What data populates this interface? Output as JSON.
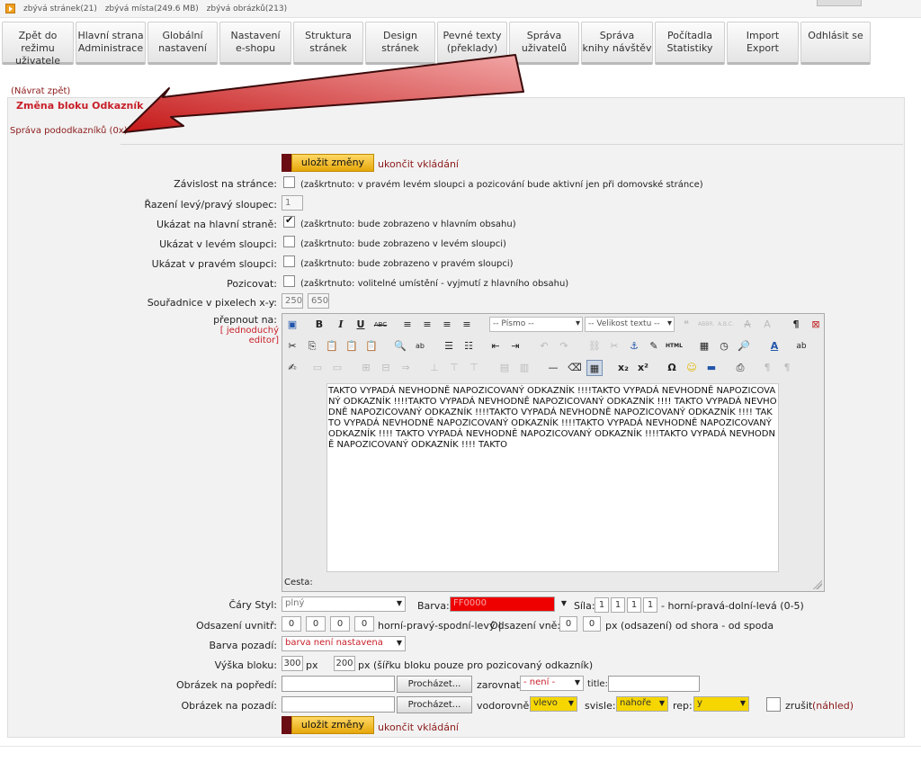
{
  "topbar": {
    "stat_pages": "zbývá stránek(21)",
    "stat_space": "zbývá místa(249.6 MB)",
    "stat_images": "zbývá obrázků(213)"
  },
  "nav": {
    "items": [
      "Zpět do režimu\nuživatele",
      "Hlavní strana\nAdministrace",
      "Globální\nnastavení",
      "Nastavení\ne-shopu",
      "Struktura\nstránek",
      "Design\nstránek",
      "Pevné texty\n(překlady)",
      "Správa\nuživatelů",
      "Správa\nknihy návštěv",
      "Počítadla\nStatistiky",
      "Import\nExport",
      "Odhlásit se"
    ]
  },
  "page": {
    "back_link": "(Návrat zpět)",
    "title": "Změna bloku Odkazník",
    "sub_link": "Správa pododkazníků (0x)"
  },
  "actions": {
    "save_label": "uložit změny",
    "end_label": "ukončit vkládání"
  },
  "form": {
    "dependency_label": "Závislost na stránce:",
    "dependency_note": "(zaškrtnuto: v pravém levém sloupci a pozicování bude aktivní jen při domovské stránce)",
    "order_label": "Řazení levý/pravý sloupec:",
    "order_value": "1",
    "main_label": "Ukázat na hlavní straně:",
    "main_note": "(zaškrtnuto: bude zobrazeno v hlavním obsahu)",
    "main_checked": true,
    "left_label": "Ukázat v levém sloupci:",
    "left_note": "(zaškrtnuto: bude zobrazeno v levém sloupci)",
    "right_label": "Ukázat v pravém sloupci:",
    "right_note": "(zaškrtnuto: bude zobrazeno v pravém sloupci)",
    "position_label": "Pozicovat:",
    "position_note": "(zaškrtnuto: volitelné umístění - vyjmutí z hlavního obsahu)",
    "coords_label": "Souřadnice v pixelech x-y:",
    "coord_x": "250",
    "coord_y": "650",
    "switch_label": "přepnout na:",
    "simple_editor": "[ jednoduchý editor]"
  },
  "editor": {
    "font_dropdown": "-- Písmo --",
    "size_dropdown": "-- Velikost textu --",
    "content": "TAKTO VYPADÁ NEVHODNĚ NAPOZICOVANÝ ODKAZNÍK !!!!TAKTO VYPADÁ NEVHODNĚ NAPOZICOVANÝ ODKAZNÍK !!!!TAKTO VYPADÁ NEVHODNĚ NAPOZICOVANÝ ODKAZNÍK !!!! TAKTO VYPADÁ NEVHODNĚ NAPOZICOVANÝ ODKAZNÍK !!!!TAKTO VYPADÁ NEVHODNĚ NAPOZICOVANÝ ODKAZNÍK !!!! TAKTO VYPADÁ NEVHODNĚ NAPOZICOVANÝ ODKAZNÍK !!!!TAKTO VYPADÁ NEVHODNĚ NAPOZICOVANÝ ODKAZNÍK !!!! TAKTO VYPADÁ NEVHODNĚ NAPOZICOVANÝ ODKAZNÍK !!!!TAKTO VYPADÁ NEVHODNĚ NAPOZICOVANÝ ODKAZNÍK !!!! TAKTO",
    "path_label": "Cesta:"
  },
  "style": {
    "lines_label": "Čáry Styl:",
    "lines_value": "plný",
    "color_label": "Barva:",
    "color_value": "FF0000",
    "weight_label": "Síla:",
    "weights": [
      "1",
      "1",
      "1",
      "1"
    ],
    "weight_note": "- horní-pravá-dolní-levá (0-5)",
    "inner_label": "Odsazení uvnitř:",
    "inner": [
      "0",
      "0",
      "0",
      "0"
    ],
    "inner_note": "horní-pravý-spodní-levý |",
    "outer_label": "Odsazení vně:",
    "outer": [
      "0",
      "0"
    ],
    "outer_note": "px (odsazení) od shora - od spoda",
    "bg_label": "Barva pozadí:",
    "bg_value": "barva není nastavena",
    "height_label": "Výška bloku:",
    "height_value": "300",
    "px": "px",
    "width_value": "200",
    "width_note": "px (šířku bloku pouze pro pozicovaný odkazník)",
    "fg_image_label": "Obrázek na popředí:",
    "browse": "Procházet...",
    "align_label": "zarovnat:",
    "align_value": "- není -",
    "title_label": "title:",
    "bg_image_label": "Obrázek na pozadí:",
    "horiz_label": "vodorovně:",
    "horiz_value": "vlevo",
    "vert_label": "svisle:",
    "vert_value": "nahoře",
    "rep_label": "rep:",
    "rep_value": "y",
    "cancel_label": "zrušit",
    "preview_label": "(náhled)"
  },
  "colors": {
    "accent_red": "#c8202a",
    "link_red": "#8b1a1a",
    "save_btn": "#f0b820",
    "arrow": "#d8282a"
  }
}
